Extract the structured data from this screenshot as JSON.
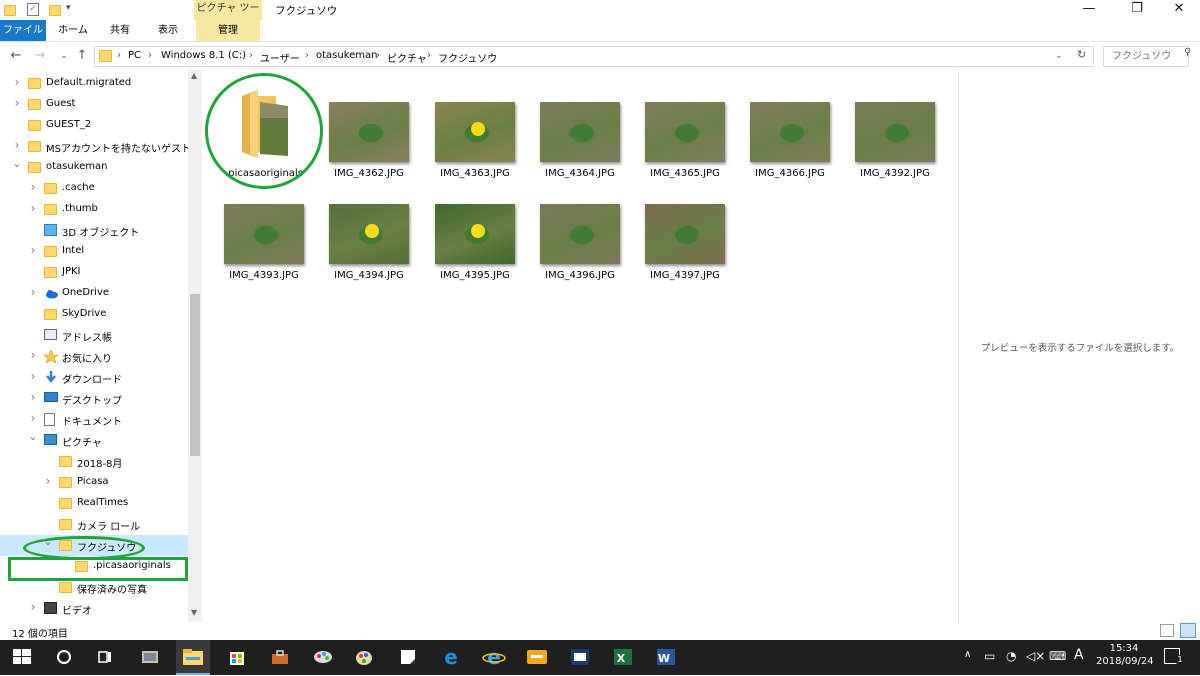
{
  "window": {
    "title": "フクジュソウ",
    "context_tab_header": "ピクチャ ツール",
    "controls": {
      "minimize": "—",
      "maximize": "❐",
      "close": "✕"
    }
  },
  "ribbon": {
    "tabs": [
      "ファイル",
      "ホーム",
      "共有",
      "表示",
      "管理"
    ]
  },
  "address": {
    "breadcrumbs": [
      "PC",
      "Windows 8.1 (C:)",
      "ユーザー",
      "otasukeman",
      "ピクチャ",
      "フクジュソウ"
    ],
    "search_placeholder": "フクジュソウ"
  },
  "nav": {
    "items": [
      {
        "label": "Default.migrated",
        "icon": "folder-icon",
        "arrow": ">"
      },
      {
        "label": "Guest",
        "icon": "folder-icon",
        "arrow": ">"
      },
      {
        "label": "GUEST_2",
        "icon": "folder-icon",
        "arrow": ""
      },
      {
        "label": "MSアカウントを持たないゲスト",
        "icon": "folder-icon",
        "arrow": ">"
      },
      {
        "label": "otasukeman",
        "icon": "folder-icon",
        "arrow": "v"
      },
      {
        "label": ".cache",
        "icon": "folder-icon",
        "arrow": ">"
      },
      {
        "label": ".thumb",
        "icon": "folder-icon",
        "arrow": ">"
      },
      {
        "label": "3D オブジェクト",
        "icon": "3d-objects-icon",
        "arrow": ""
      },
      {
        "label": "Intel",
        "icon": "folder-icon",
        "arrow": ">"
      },
      {
        "label": "JPKI",
        "icon": "folder-icon",
        "arrow": ""
      },
      {
        "label": "OneDrive",
        "icon": "onedrive-icon",
        "arrow": ">"
      },
      {
        "label": "SkyDrive",
        "icon": "folder-icon",
        "arrow": ""
      },
      {
        "label": "アドレス帳",
        "icon": "contacts-icon",
        "arrow": ""
      },
      {
        "label": "お気に入り",
        "icon": "favorites-icon",
        "arrow": ">"
      },
      {
        "label": "ダウンロード",
        "icon": "download-icon",
        "arrow": ">"
      },
      {
        "label": "デスクトップ",
        "icon": "desktop-icon",
        "arrow": ">"
      },
      {
        "label": "ドキュメント",
        "icon": "documents-icon",
        "arrow": ">"
      },
      {
        "label": "ピクチャ",
        "icon": "pictures-icon",
        "arrow": "v"
      },
      {
        "label": "2018-8月",
        "icon": "folder-icon",
        "arrow": ""
      },
      {
        "label": "Picasa",
        "icon": "folder-icon",
        "arrow": ">"
      },
      {
        "label": "RealTimes",
        "icon": "folder-icon",
        "arrow": ""
      },
      {
        "label": "カメラ ロール",
        "icon": "folder-icon",
        "arrow": ""
      },
      {
        "label": "フクジュソウ",
        "icon": "folder-icon",
        "arrow": "v"
      },
      {
        "label": ".picasaoriginals",
        "icon": "folder-icon",
        "arrow": ""
      },
      {
        "label": "保存済みの写真",
        "icon": "folder-icon",
        "arrow": ""
      },
      {
        "label": "ビデオ",
        "icon": "videos-icon",
        "arrow": ">"
      }
    ]
  },
  "files": [
    {
      "name": ".picasaoriginals",
      "kind": "folder"
    },
    {
      "name": "IMG_4362.JPG",
      "kind": "photo",
      "tone": "#8a7f63"
    },
    {
      "name": "IMG_4363.JPG",
      "kind": "photo",
      "tone": "#8b8450"
    },
    {
      "name": "IMG_4364.JPG",
      "kind": "photo",
      "tone": "#7e7a5e"
    },
    {
      "name": "IMG_4365.JPG",
      "kind": "photo",
      "tone": "#827d60"
    },
    {
      "name": "IMG_4366.JPG",
      "kind": "photo",
      "tone": "#857c60"
    },
    {
      "name": "IMG_4392.JPG",
      "kind": "photo",
      "tone": "#7b7a5c"
    },
    {
      "name": "IMG_4393.JPG",
      "kind": "photo",
      "tone": "#807a5e"
    },
    {
      "name": "IMG_4394.JPG",
      "kind": "photo",
      "tone": "#56703a"
    },
    {
      "name": "IMG_4395.JPG",
      "kind": "photo",
      "tone": "#3f6a2e"
    },
    {
      "name": "IMG_4396.JPG",
      "kind": "photo",
      "tone": "#7c775c"
    },
    {
      "name": "IMG_4397.JPG",
      "kind": "photo",
      "tone": "#7d6d50"
    }
  ],
  "preview_message": "プレビューを表示するファイルを選択します。",
  "status": {
    "item_count": "12 個の項目"
  },
  "taskbar": {
    "apps": [
      "start-icon",
      "cortana-icon",
      "task-view-icon",
      "app-icon",
      "file-explorer-icon",
      "store-icon",
      "toolbox-icon",
      "paint-icon",
      "paint-palette-icon",
      "sticky-notes-icon",
      "edge-icon",
      "internet-explorer-icon",
      "slide-app-icon",
      "image-app-icon",
      "excel-icon",
      "word-icon"
    ],
    "clock_time": "15:34",
    "clock_date": "2018/09/24",
    "ime": "A",
    "notification_count": "1"
  },
  "annotation_color": "#1fa33a"
}
